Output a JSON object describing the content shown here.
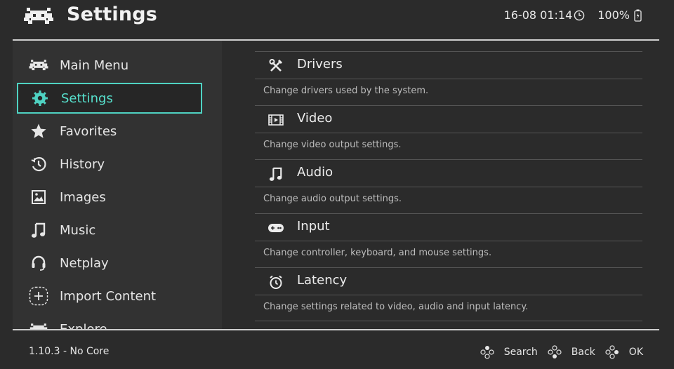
{
  "header": {
    "title": "Settings",
    "datetime": "16-08 01:14",
    "battery": "100%"
  },
  "sidebar": {
    "items": [
      {
        "label": "Main Menu",
        "icon": "retroarch-icon"
      },
      {
        "label": "Settings",
        "icon": "gear-icon",
        "selected": true
      },
      {
        "label": "Favorites",
        "icon": "star-icon"
      },
      {
        "label": "History",
        "icon": "history-icon"
      },
      {
        "label": "Images",
        "icon": "image-icon"
      },
      {
        "label": "Music",
        "icon": "music-icon"
      },
      {
        "label": "Netplay",
        "icon": "headset-icon"
      },
      {
        "label": "Import Content",
        "icon": "plus-icon"
      },
      {
        "label": "Explore",
        "icon": "retroarch-icon"
      }
    ]
  },
  "main": {
    "entries": [
      {
        "label": "Drivers",
        "desc": "Change drivers used by the system.",
        "icon": "tools-icon"
      },
      {
        "label": "Video",
        "desc": "Change video output settings.",
        "icon": "film-icon"
      },
      {
        "label": "Audio",
        "desc": "Change audio output settings.",
        "icon": "music-icon"
      },
      {
        "label": "Input",
        "desc": "Change controller, keyboard, and mouse settings.",
        "icon": "gamepad-icon"
      },
      {
        "label": "Latency",
        "desc": "Change settings related to video, audio and input latency.",
        "icon": "stopwatch-icon"
      }
    ]
  },
  "footer": {
    "version": "1.10.3 - No Core",
    "buttons": [
      {
        "label": "Search",
        "icon": "face-buttons-icon"
      },
      {
        "label": "Back",
        "icon": "face-buttons-icon"
      },
      {
        "label": "OK",
        "icon": "face-buttons-icon"
      }
    ]
  },
  "colors": {
    "background": "#2b2b2b",
    "sidebar": "#323232",
    "accent": "#4fd2c2",
    "text": "#e8e8e8"
  }
}
